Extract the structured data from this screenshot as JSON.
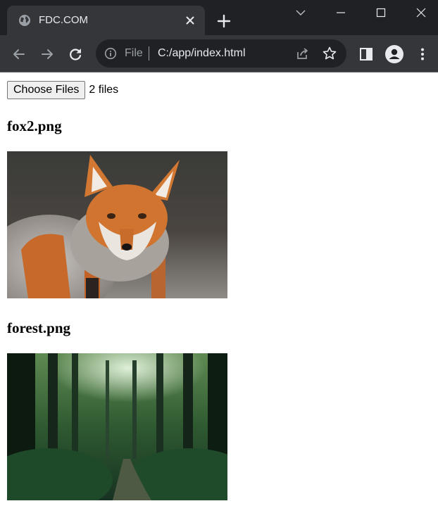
{
  "browser": {
    "tab": {
      "title": "FDC.COM"
    },
    "address_bar": {
      "scheme_label": "File",
      "url": "C:/app/index.html"
    }
  },
  "page": {
    "file_input": {
      "button_label": "Choose Files",
      "status": "2 files"
    },
    "images": [
      {
        "filename": "fox2.png",
        "depicts": "red fox"
      },
      {
        "filename": "forest.png",
        "depicts": "forest path"
      }
    ]
  }
}
